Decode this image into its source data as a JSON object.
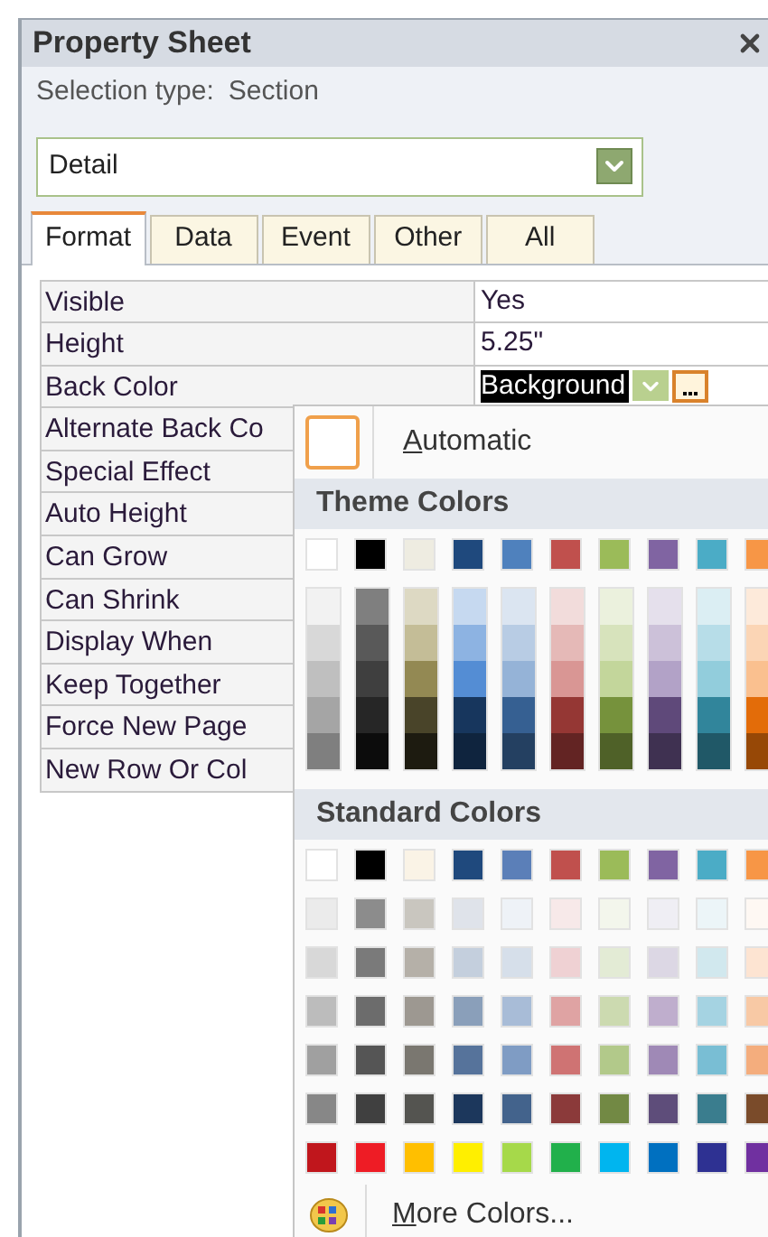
{
  "window": {
    "title": "Property Sheet"
  },
  "selection": {
    "label": "Selection type:",
    "value": "Section"
  },
  "object_dropdown": {
    "value": "Detail"
  },
  "tabs": [
    {
      "label": "Format",
      "selected": true
    },
    {
      "label": "Data",
      "selected": false
    },
    {
      "label": "Event",
      "selected": false
    },
    {
      "label": "Other",
      "selected": false
    },
    {
      "label": "All",
      "selected": false
    }
  ],
  "properties": [
    {
      "name": "Visible",
      "value": "Yes"
    },
    {
      "name": "Height",
      "value": "5.25\""
    },
    {
      "name": "Back Color",
      "value": "Background",
      "selected": true
    },
    {
      "name": "Alternate Back Co"
    },
    {
      "name": "Special Effect"
    },
    {
      "name": "Auto Height"
    },
    {
      "name": "Can Grow"
    },
    {
      "name": "Can Shrink"
    },
    {
      "name": "Display When"
    },
    {
      "name": "Keep Together"
    },
    {
      "name": "Force New Page"
    },
    {
      "name": "New Row Or Col"
    }
  ],
  "color_menu": {
    "automatic": "Automatic",
    "theme_title": "Theme Colors",
    "theme_base": [
      {
        "color": "#ffffff"
      },
      {
        "color": "#000000"
      },
      {
        "color": "#eeece1"
      },
      {
        "color": "#1f497d"
      },
      {
        "color": "#4f81bd"
      },
      {
        "color": "#c0504d"
      },
      {
        "color": "#9bbb59"
      },
      {
        "color": "#8064a2"
      },
      {
        "color": "#4bacc6"
      },
      {
        "color": "#f79646"
      }
    ],
    "theme_shades": [
      [
        {
          "color": "#f2f2f2"
        },
        {
          "color": "#d8d8d8"
        },
        {
          "color": "#bfbfbf"
        },
        {
          "color": "#a5a5a5"
        },
        {
          "color": "#7f7f7f"
        }
      ],
      [
        {
          "color": "#7f7f7f"
        },
        {
          "color": "#595959"
        },
        {
          "color": "#3f3f3f"
        },
        {
          "color": "#262626"
        },
        {
          "color": "#0c0c0c"
        }
      ],
      [
        {
          "color": "#ddd9c3"
        },
        {
          "color": "#c4bd97"
        },
        {
          "color": "#938953"
        },
        {
          "color": "#494429"
        },
        {
          "color": "#1d1b10"
        }
      ],
      [
        {
          "color": "#c6d9f0"
        },
        {
          "color": "#8db3e2"
        },
        {
          "color": "#548dd4"
        },
        {
          "color": "#17365d"
        },
        {
          "color": "#0f243e"
        }
      ],
      [
        {
          "color": "#dbe5f1"
        },
        {
          "color": "#b8cce4"
        },
        {
          "color": "#95b3d7"
        },
        {
          "color": "#366092"
        },
        {
          "color": "#244061"
        }
      ],
      [
        {
          "color": "#f2dcdb"
        },
        {
          "color": "#e5b9b7"
        },
        {
          "color": "#d99694"
        },
        {
          "color": "#953734"
        },
        {
          "color": "#632423"
        }
      ],
      [
        {
          "color": "#ebf1dd"
        },
        {
          "color": "#d7e3bc"
        },
        {
          "color": "#c3d69b"
        },
        {
          "color": "#76923c"
        },
        {
          "color": "#4f6128"
        }
      ],
      [
        {
          "color": "#e5e0ec"
        },
        {
          "color": "#ccc1d9"
        },
        {
          "color": "#b2a2c7"
        },
        {
          "color": "#5f497a"
        },
        {
          "color": "#3f3151"
        }
      ],
      [
        {
          "color": "#dbeef3"
        },
        {
          "color": "#b7dde8"
        },
        {
          "color": "#92cddc"
        },
        {
          "color": "#31859b"
        },
        {
          "color": "#205867"
        }
      ],
      [
        {
          "color": "#fdeada"
        },
        {
          "color": "#fbd5b5"
        },
        {
          "color": "#fac08f"
        },
        {
          "color": "#e36c09"
        },
        {
          "color": "#974806"
        }
      ]
    ],
    "standard_title": "Standard Colors",
    "standard_rows": [
      [
        {
          "color": "#ffffff"
        },
        {
          "color": "#000000"
        },
        {
          "color": "#faf3e6"
        },
        {
          "color": "#1f497d"
        },
        {
          "color": "#5b7fb8"
        },
        {
          "color": "#c0504d"
        },
        {
          "color": "#9bbb59"
        },
        {
          "color": "#8064a2"
        },
        {
          "color": "#4bacc6"
        },
        {
          "color": "#f79646"
        }
      ],
      [
        {
          "color": "#ebebeb"
        },
        {
          "color": "#8c8c8c"
        },
        {
          "color": "#c9c6bf"
        },
        {
          "color": "#dfe3ea"
        },
        {
          "color": "#eef2f7"
        },
        {
          "color": "#f7e9e9"
        },
        {
          "color": "#f3f6ec"
        },
        {
          "color": "#efeef4"
        },
        {
          "color": "#ecf5f8"
        },
        {
          "color": "#fef8f3"
        }
      ],
      [
        {
          "color": "#d8d8d8"
        },
        {
          "color": "#7a7a7a"
        },
        {
          "color": "#b5b0a8"
        },
        {
          "color": "#c4cfdd"
        },
        {
          "color": "#d6dfea"
        },
        {
          "color": "#efd1d3"
        },
        {
          "color": "#e3ebd5"
        },
        {
          "color": "#dcd7e4"
        },
        {
          "color": "#d1e8ee"
        },
        {
          "color": "#fde4d2"
        }
      ],
      [
        {
          "color": "#bcbcbc"
        },
        {
          "color": "#6c6c6c"
        },
        {
          "color": "#9d9891"
        },
        {
          "color": "#8a9fba"
        },
        {
          "color": "#a8bcd7"
        },
        {
          "color": "#dfa3a3"
        },
        {
          "color": "#ccdab0"
        },
        {
          "color": "#bfaecd"
        },
        {
          "color": "#a5d3e2"
        },
        {
          "color": "#f8c9a5"
        }
      ],
      [
        {
          "color": "#a0a0a0"
        },
        {
          "color": "#555555"
        },
        {
          "color": "#7a7770"
        },
        {
          "color": "#56739b"
        },
        {
          "color": "#7f9cc4"
        },
        {
          "color": "#cf7373"
        },
        {
          "color": "#b2c98a"
        },
        {
          "color": "#9f89b6"
        },
        {
          "color": "#79bed4"
        },
        {
          "color": "#f4ad7d"
        }
      ],
      [
        {
          "color": "#878787"
        },
        {
          "color": "#404040"
        },
        {
          "color": "#545450"
        },
        {
          "color": "#1c375c"
        },
        {
          "color": "#43638c"
        },
        {
          "color": "#8b3a3a"
        },
        {
          "color": "#728944"
        },
        {
          "color": "#5e4d7a"
        },
        {
          "color": "#3a7d8e"
        },
        {
          "color": "#7a4b2a"
        }
      ],
      [
        {
          "color": "#c0161c"
        },
        {
          "color": "#ee1c25"
        },
        {
          "color": "#ffbf00"
        },
        {
          "color": "#ffef00"
        },
        {
          "color": "#a6d94a"
        },
        {
          "color": "#21b04b"
        },
        {
          "color": "#00b5ef"
        },
        {
          "color": "#0070c0"
        },
        {
          "color": "#2e3192"
        },
        {
          "color": "#7030a0"
        }
      ]
    ],
    "more": "More Colors..."
  }
}
